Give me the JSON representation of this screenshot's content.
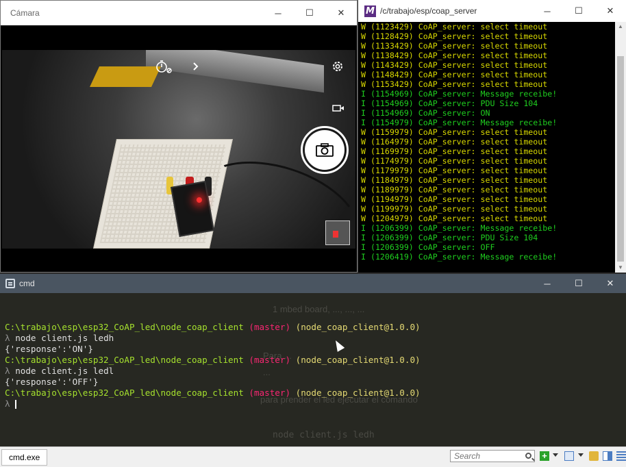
{
  "camera": {
    "title": "Cámara",
    "controls": {
      "minimize": "─",
      "maximize": "☐",
      "close": "✕"
    }
  },
  "server_terminal": {
    "logo": "M",
    "title": "/c/trabajo/esp/coap_server",
    "lines": [
      {
        "level": "W",
        "text": "W (1123429) CoAP_server: select timeout"
      },
      {
        "level": "W",
        "text": "W (1128429) CoAP_server: select timeout"
      },
      {
        "level": "W",
        "text": "W (1133429) CoAP_server: select timeout"
      },
      {
        "level": "W",
        "text": "W (1138429) CoAP_server: select timeout"
      },
      {
        "level": "W",
        "text": "W (1143429) CoAP_server: select timeout"
      },
      {
        "level": "W",
        "text": "W (1148429) CoAP_server: select timeout"
      },
      {
        "level": "W",
        "text": "W (1153429) CoAP_server: select timeout"
      },
      {
        "level": "I",
        "text": "I (1154969) CoAP_server: Message receibe!"
      },
      {
        "level": "I",
        "text": "I (1154969) CoAP_server: PDU Size 104"
      },
      {
        "level": "I",
        "text": "I (1154969) CoAP_server: ON"
      },
      {
        "level": "I",
        "text": "I (1154979) CoAP_server: Message receibe!"
      },
      {
        "level": "W",
        "text": "W (1159979) CoAP_server: select timeout"
      },
      {
        "level": "W",
        "text": "W (1164979) CoAP_server: select timeout"
      },
      {
        "level": "W",
        "text": "W (1169979) CoAP_server: select timeout"
      },
      {
        "level": "W",
        "text": "W (1174979) CoAP_server: select timeout"
      },
      {
        "level": "W",
        "text": "W (1179979) CoAP_server: select timeout"
      },
      {
        "level": "W",
        "text": "W (1184979) CoAP_server: select timeout"
      },
      {
        "level": "W",
        "text": "W (1189979) CoAP_server: select timeout"
      },
      {
        "level": "W",
        "text": "W (1194979) CoAP_server: select timeout"
      },
      {
        "level": "W",
        "text": "W (1199979) CoAP_server: select timeout"
      },
      {
        "level": "W",
        "text": "W (1204979) CoAP_server: select timeout"
      },
      {
        "level": "I",
        "text": "I (1206399) CoAP_server: Message receibe!"
      },
      {
        "level": "I",
        "text": "I (1206399) CoAP_server: PDU Size 104"
      },
      {
        "level": "I",
        "text": "I (1206399) CoAP_server: OFF"
      },
      {
        "level": "I",
        "text": "I (1206419) CoAP_server: Message receibe!"
      }
    ]
  },
  "cmd": {
    "title": "cmd",
    "prompt_path": "C:\\trabajo\\esp\\esp32_CoAP_led\\node_coap_client",
    "branch": "(master)",
    "package": "(node_coap_client@1.0.0)",
    "lambda": "λ",
    "command1": "node client.js ledh",
    "response1": "{'response':'ON'}",
    "command2": "node client.js ledl",
    "response2": "{'response':'OFF'}",
    "background_text": [
      "1 mbed board, ..., ..., ...",
      "...",
      "Para ...",
      "...",
      "para prender el led ejecutar el comando",
      "node client.js ledh"
    ]
  },
  "statusbar": {
    "tab_label": "cmd.exe",
    "search_placeholder": "Search"
  }
}
